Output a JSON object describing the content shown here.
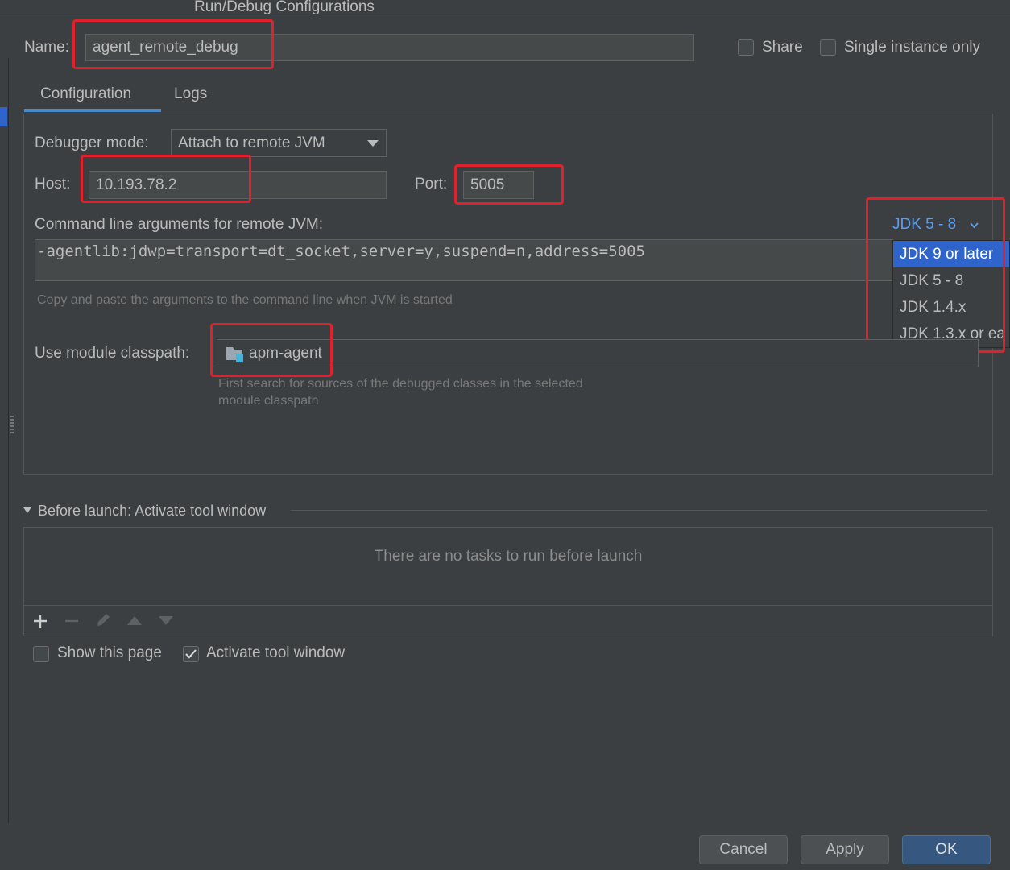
{
  "window": {
    "title": "Run/Debug Configurations"
  },
  "name": {
    "label": "Name:",
    "value": "agent_remote_debug"
  },
  "share": {
    "label": "Share",
    "checked": false
  },
  "single_instance": {
    "label": "Single instance only",
    "checked": false
  },
  "tabs": [
    {
      "label": "Configuration",
      "active": true
    },
    {
      "label": "Logs",
      "active": false
    }
  ],
  "debugger_mode": {
    "label": "Debugger mode:",
    "value": "Attach to remote JVM"
  },
  "host": {
    "label": "Host:",
    "value": "10.193.78.2"
  },
  "port": {
    "label": "Port:",
    "value": "5005"
  },
  "cmdline": {
    "label": "Command line arguments for remote JVM:",
    "value": "-agentlib:jdwp=transport=dt_socket,server=y,suspend=n,address=5005",
    "hint": "Copy and paste the arguments to the command line when JVM is started"
  },
  "jdk": {
    "selected_label": "JDK 5 - 8",
    "options": [
      "JDK 9 or later",
      "JDK 5 - 8",
      "JDK 1.4.x",
      "JDK 1.3.x or ea"
    ],
    "highlighted_index": 0
  },
  "module_classpath": {
    "label": "Use module classpath:",
    "value": "apm-agent",
    "hint_line1": "First search for sources of the debugged classes in the selected",
    "hint_line2": "module classpath"
  },
  "before_launch": {
    "title": "Before launch: Activate tool window",
    "empty_text": "There are no tasks to run before launch"
  },
  "show_page": {
    "label": "Show this page",
    "checked": false
  },
  "activate_tool_window": {
    "label": "Activate tool window",
    "checked": true
  },
  "buttons": {
    "cancel": "Cancel",
    "apply": "Apply",
    "ok": "OK"
  },
  "colors": {
    "background": "#3c3f41",
    "accent": "#4a88c7",
    "selection": "#2f65ca",
    "highlight_box": "#e0202a",
    "link": "#589df6"
  }
}
